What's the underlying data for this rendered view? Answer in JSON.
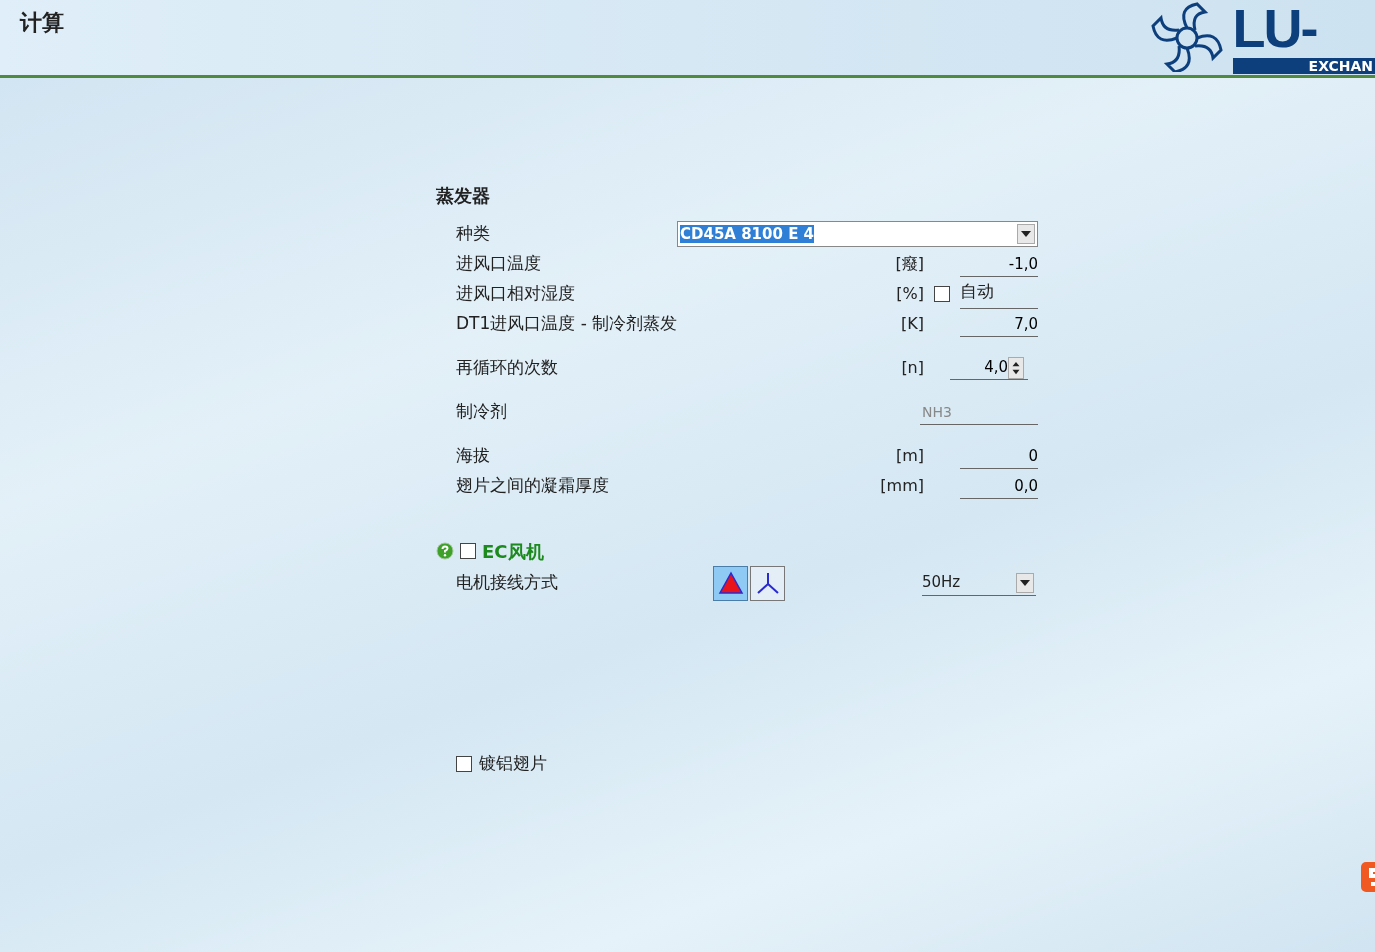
{
  "header": {
    "title": "计算",
    "logo_text": "LU-",
    "logo_subtext": "EXCHAN"
  },
  "section": {
    "title": "蒸发器",
    "groups": [
      {
        "rows": [
          {
            "kind": "select",
            "label": "种类",
            "value": "CD45A 8100 E 4"
          },
          {
            "kind": "number",
            "label": "进风口温度",
            "unit": "[癈]",
            "value": "-1,0"
          },
          {
            "kind": "check",
            "label": "进风口相对湿度",
            "unit": "[%]",
            "checked": false,
            "value": "自动"
          },
          {
            "kind": "number",
            "label": "DT1进风口温度 - 制冷剂蒸发",
            "unit": "[K]",
            "value": "7,0"
          }
        ]
      },
      {
        "rows": [
          {
            "kind": "spin",
            "label": "再循环的次数",
            "unit": "[n]",
            "value": "4,0"
          }
        ]
      },
      {
        "rows": [
          {
            "kind": "readonly",
            "label": "制冷剂",
            "value": "NH3",
            "disabled": true
          }
        ]
      },
      {
        "rows": [
          {
            "kind": "number",
            "label": "海拔",
            "unit": "[m]",
            "value": "0"
          },
          {
            "kind": "number",
            "label": "翅片之间的凝霜厚度",
            "unit": "[mm]",
            "value": "0,0"
          }
        ]
      }
    ]
  },
  "ec_fan": {
    "label": "EC风机",
    "checked": false,
    "motor": {
      "label": "电机接线方式",
      "connections": [
        {
          "kind": "delta",
          "selected": true
        },
        {
          "kind": "star",
          "selected": false
        }
      ],
      "frequency": "50Hz"
    }
  },
  "coated_fins": {
    "label": "镀铝翅片",
    "checked": false
  }
}
